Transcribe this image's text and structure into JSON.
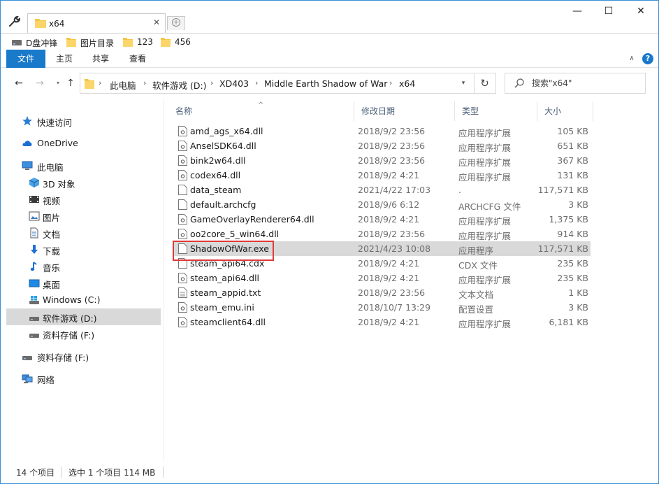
{
  "window": {
    "tab_title": "x64",
    "tab_close": "✕",
    "new_tab": "+",
    "minimize": "—",
    "maximize": "☐",
    "close": "✕"
  },
  "favorites": [
    {
      "label": "D盘冲锋",
      "icon": "drive-icon"
    },
    {
      "label": "图片目录",
      "icon": "folder-icon"
    },
    {
      "label": "123",
      "icon": "folder-icon"
    },
    {
      "label": "456",
      "icon": "folder-icon"
    }
  ],
  "ribbon": {
    "tabs": [
      "文件",
      "主页",
      "共享",
      "查看"
    ],
    "collapse": "∧",
    "help": "?"
  },
  "nav": {
    "back": "←",
    "forward": "→",
    "recent": "▾",
    "up": "↑",
    "breadcrumb": [
      "此电脑",
      "软件游戏 (D:)",
      "XD403",
      "Middle Earth Shadow of War",
      "x64"
    ],
    "separator": "›",
    "dropdown": "▾",
    "refresh": "↻",
    "search_placeholder": "搜索\"x64\""
  },
  "sidebar": {
    "items": [
      {
        "label": "快速访问",
        "icon": "star-icon"
      },
      {
        "label": "OneDrive",
        "icon": "cloud-icon"
      },
      {
        "label": "此电脑",
        "icon": "computer-icon"
      },
      {
        "label": "3D 对象",
        "icon": "cube-icon"
      },
      {
        "label": "视频",
        "icon": "video-icon"
      },
      {
        "label": "图片",
        "icon": "picture-icon"
      },
      {
        "label": "文档",
        "icon": "document-icon"
      },
      {
        "label": "下载",
        "icon": "download-icon"
      },
      {
        "label": "音乐",
        "icon": "music-icon"
      },
      {
        "label": "桌面",
        "icon": "desktop-icon"
      },
      {
        "label": "Windows (C:)",
        "icon": "windows-drive-icon"
      },
      {
        "label": "软件游戏 (D:)",
        "icon": "drive-icon"
      },
      {
        "label": "资料存储 (F:)",
        "icon": "drive-icon"
      },
      {
        "label": "资料存储 (F:)",
        "icon": "drive-icon"
      },
      {
        "label": "网络",
        "icon": "network-icon"
      }
    ]
  },
  "columns": {
    "name": "名称",
    "date": "修改日期",
    "type": "类型",
    "size": "大小",
    "sort_indicator": "^"
  },
  "files": [
    {
      "name": "amd_ags_x64.dll",
      "date": "2018/9/2 23:56",
      "type": "应用程序扩展",
      "size": "105 KB",
      "icon": "dll-icon"
    },
    {
      "name": "AnselSDK64.dll",
      "date": "2018/9/2 23:56",
      "type": "应用程序扩展",
      "size": "651 KB",
      "icon": "dll-icon"
    },
    {
      "name": "bink2w64.dll",
      "date": "2018/9/2 23:56",
      "type": "应用程序扩展",
      "size": "367 KB",
      "icon": "dll-icon"
    },
    {
      "name": "codex64.dll",
      "date": "2018/9/2 4:21",
      "type": "应用程序扩展",
      "size": "131 KB",
      "icon": "dll-icon"
    },
    {
      "name": "data_steam",
      "date": "2021/4/22 17:03",
      "type": ".",
      "size": "117,571 KB",
      "icon": "file-icon"
    },
    {
      "name": "default.archcfg",
      "date": "2018/9/6 6:12",
      "type": "ARCHCFG 文件",
      "size": "3 KB",
      "icon": "file-icon"
    },
    {
      "name": "GameOverlayRenderer64.dll",
      "date": "2018/9/2 4:21",
      "type": "应用程序扩展",
      "size": "1,375 KB",
      "icon": "dll-icon"
    },
    {
      "name": "oo2core_5_win64.dll",
      "date": "2018/9/2 23:56",
      "type": "应用程序扩展",
      "size": "914 KB",
      "icon": "dll-icon"
    },
    {
      "name": "ShadowOfWar.exe",
      "date": "2021/4/23 10:08",
      "type": "应用程序",
      "size": "117,571 KB",
      "icon": "file-icon"
    },
    {
      "name": "steam_api64.cdx",
      "date": "2018/9/2 4:21",
      "type": "CDX 文件",
      "size": "235 KB",
      "icon": "file-icon"
    },
    {
      "name": "steam_api64.dll",
      "date": "2018/9/2 4:21",
      "type": "应用程序扩展",
      "size": "235 KB",
      "icon": "dll-icon"
    },
    {
      "name": "steam_appid.txt",
      "date": "2018/9/2 23:56",
      "type": "文本文档",
      "size": "1 KB",
      "icon": "text-file-icon"
    },
    {
      "name": "steam_emu.ini",
      "date": "2018/10/7 13:29",
      "type": "配置设置",
      "size": "3 KB",
      "icon": "settings-file-icon"
    },
    {
      "name": "steamclient64.dll",
      "date": "2018/9/2 4:21",
      "type": "应用程序扩展",
      "size": "6,181 KB",
      "icon": "dll-icon"
    }
  ],
  "status": {
    "count": "14 个项目",
    "selection": "选中 1 个项目  114 MB"
  },
  "colors": {
    "accent": "#1979ca",
    "selection": "#d9d9d9",
    "highlight_box": "#e03a3a",
    "folder": "#f5c542"
  }
}
